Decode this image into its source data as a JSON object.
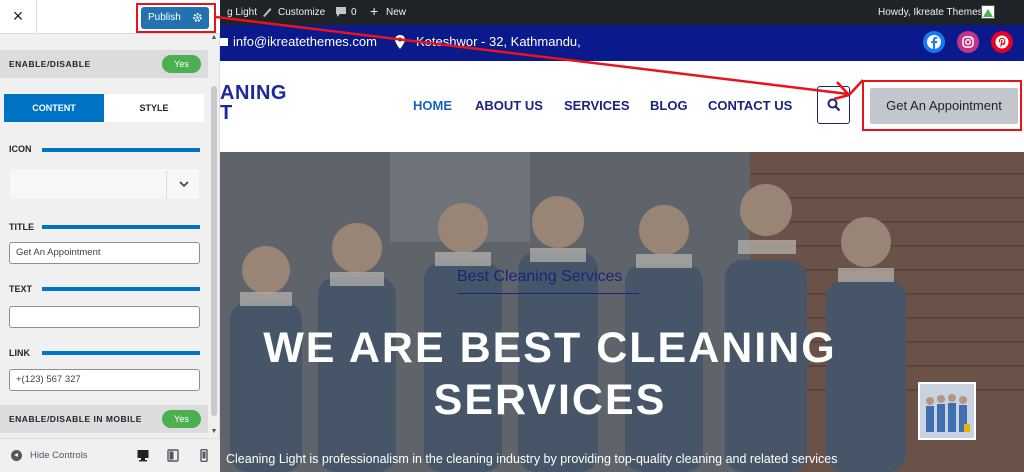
{
  "customizer": {
    "close_label": "×",
    "publish_label": "Publish",
    "toggle_on_label": "Yes",
    "enable_disable_label": "ENABLE/DISABLE",
    "tabs": {
      "content": "CONTENT",
      "style": "STYLE"
    },
    "icon_label": "ICON",
    "title_label": "TITLE",
    "title_value": "Get An Appointment",
    "text_label": "TEXT",
    "text_value": "",
    "link_label": "LINK",
    "link_value": "+(123) 567 327",
    "mobile_label": "ENABLE/DISABLE IN MOBILE",
    "hide_controls_label": "Hide Controls",
    "devices": [
      "desktop-icon",
      "tablet-icon",
      "mobile-icon"
    ]
  },
  "adminbar": {
    "site_name": "g Light",
    "customize_label": "Customize",
    "comments_count": "0",
    "new_label": "New",
    "howdy": "Howdy, Ikreate Themes"
  },
  "topbar": {
    "email": "info@ikreatethemes.com",
    "address": "Koteshwor - 32, Kathmandu,",
    "social": [
      "facebook-icon",
      "instagram-icon",
      "pinterest-icon"
    ]
  },
  "header": {
    "logo_line1": "ANING",
    "logo_line2": "T",
    "nav": [
      "HOME",
      "ABOUT US",
      "SERVICES",
      "BLOG",
      "CONTACT US"
    ],
    "cta_label": "Get An Appointment"
  },
  "hero": {
    "subtitle": "Best Cleaning Services",
    "title_line1": "WE ARE BEST CLEANING",
    "title_line2": "SERVICES",
    "description": "Cleaning Light is professionalism in the cleaning industry by providing top-quality cleaning and related services"
  },
  "colors": {
    "accent": "#0073c4",
    "toggle_green": "#4caf50",
    "topbar_blue": "#0a1a8c",
    "nav_blue": "#1a237e",
    "annotation_red": "#e8141b"
  }
}
